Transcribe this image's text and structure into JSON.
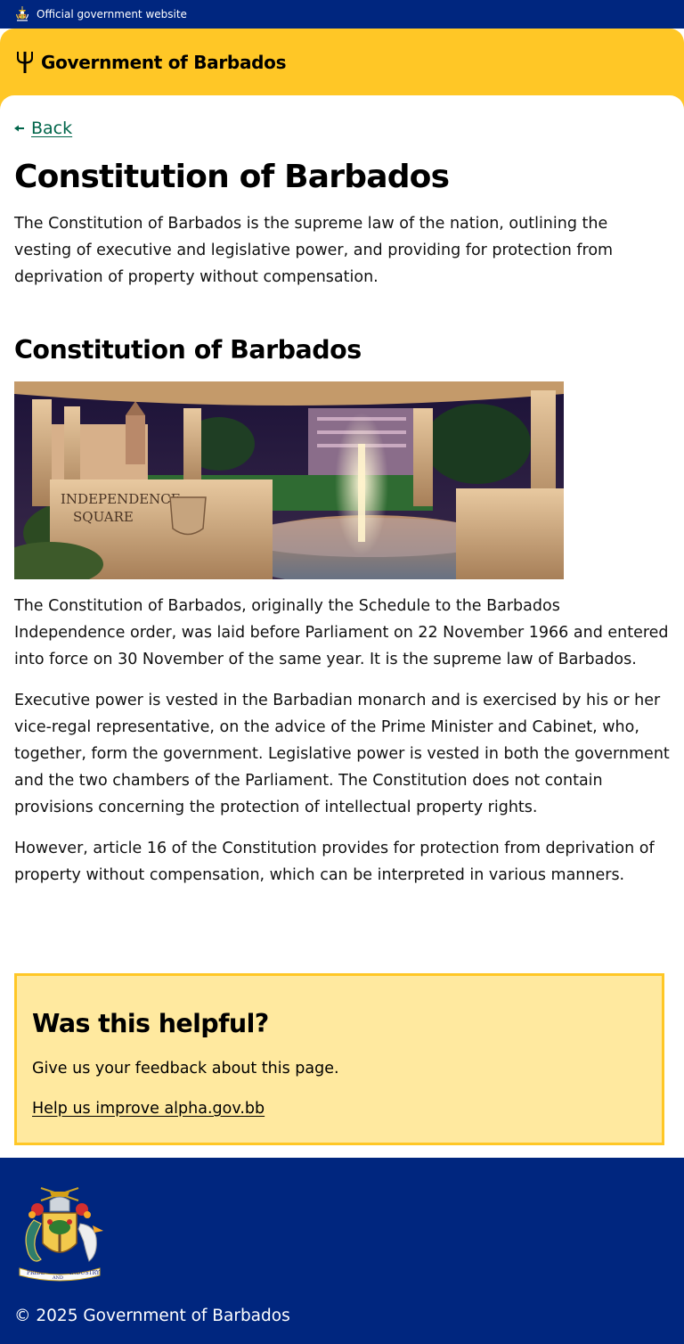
{
  "banner": {
    "text": "Official government website",
    "crest_icon": "coat-of-arms-icon"
  },
  "header": {
    "brand": "Government of Barbados",
    "logo_icon": "trident-icon",
    "colors": {
      "banner_bg": "#00267f",
      "header_bg": "#ffc726",
      "link": "#00654a"
    }
  },
  "nav": {
    "back_label": "Back",
    "back_icon": "arrow-left-icon"
  },
  "page": {
    "title": "Constitution of Barbados",
    "lead": "The Constitution of Barbados is the supreme law of the nation, outlining the vesting of executive and legislative power, and providing for protection from deprivation of property without compensation.",
    "section_heading": "Constitution of Barbados",
    "paragraphs": [
      "The Constitution of Barbados, originally the Schedule to the Barbados Independence order, was laid before Parliament on 22 November 1966 and entered into force on 30 November of the same year. It is the supreme law of Barbados.",
      "Executive power is vested in the Barbadian monarch and is exercised by his or her vice-regal representative, on the advice of the Prime Minister and Cabinet, who, together, form the government. Legislative power is vested in both the government and the two chambers of the Parliament. The Constitution does not contain provisions concerning the protection of intellectual property rights.",
      "However, article 16 of the Constitution provides for protection from deprivation of property without compensation, which can be interpreted in various manners."
    ],
    "photo_sign_line1": "INDEPENDENCE",
    "photo_sign_line2": "SQUARE"
  },
  "feedback": {
    "heading": "Was this helpful?",
    "text": "Give us your feedback about this page.",
    "link_label": "Help us improve alpha.gov.bb",
    "colors": {
      "bg": "#ffe99f",
      "border": "#ffc726"
    }
  },
  "footer": {
    "coat_icon": "coat-of-arms-icon",
    "motto_left": "PRIDE",
    "motto_mid": "AND",
    "motto_right": "INDUSTRY",
    "copyright": "© 2025 Government of Barbados"
  }
}
